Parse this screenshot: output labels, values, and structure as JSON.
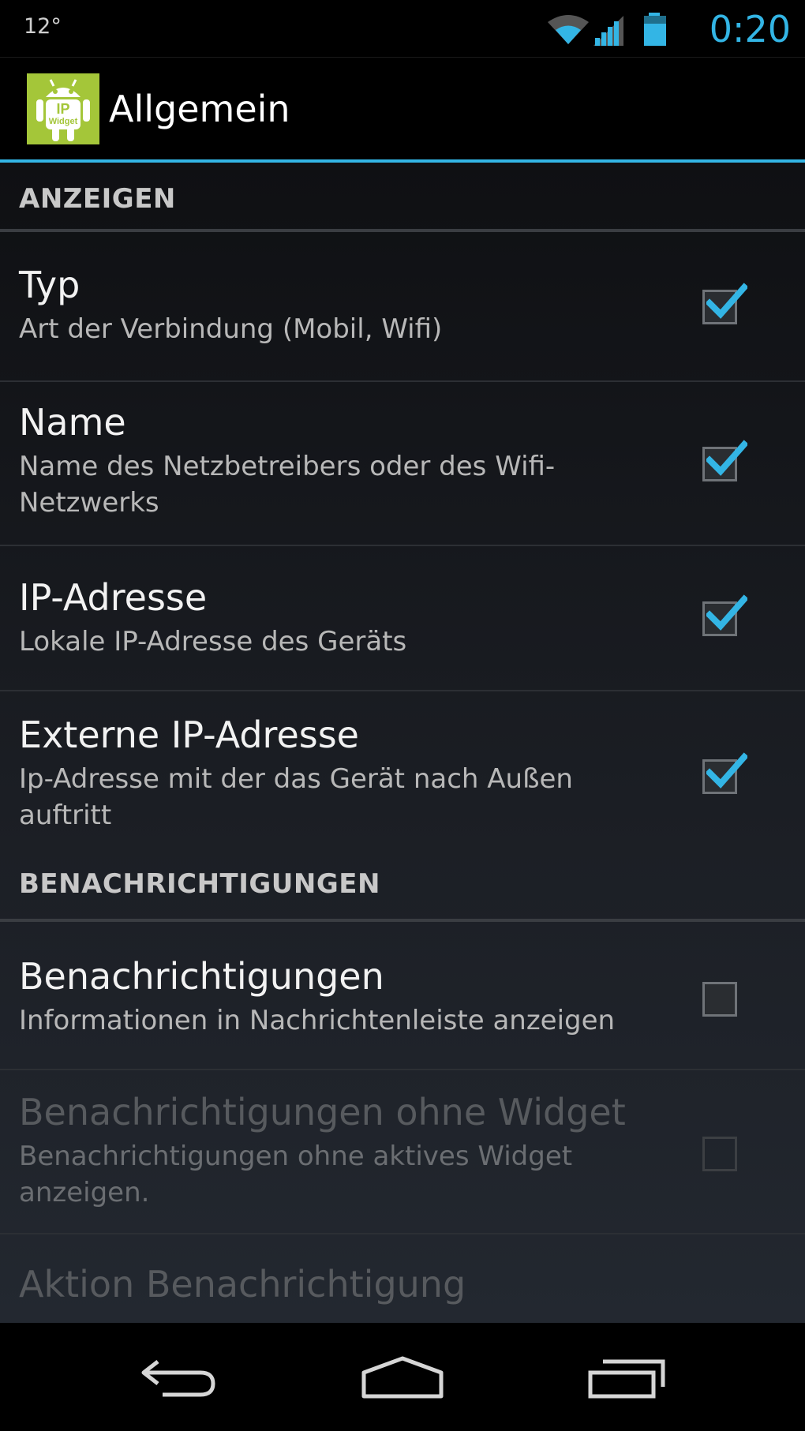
{
  "status_bar": {
    "temperature": "12°",
    "time": "0:20",
    "icons": [
      "wifi-icon",
      "cellular-signal-icon",
      "battery-icon"
    ]
  },
  "action_bar": {
    "title": "Allgemein",
    "app_icon": "ip-widget-android-icon",
    "app_icon_text_1": "IP",
    "app_icon_text_2": "Widget"
  },
  "categories": [
    {
      "label": "ANZEIGEN",
      "items": [
        {
          "title": "Typ",
          "summary": "Art der Verbindung (Mobil, Wifi)",
          "checked": true,
          "enabled": true
        },
        {
          "title": "Name",
          "summary": "Name des Netzbetreibers oder des Wifi-Netzwerks",
          "checked": true,
          "enabled": true
        },
        {
          "title": "IP-Adresse",
          "summary": "Lokale IP-Adresse des Geräts",
          "checked": true,
          "enabled": true
        },
        {
          "title": "Externe IP-Adresse",
          "summary": "Ip-Adresse mit der das Gerät nach Außen auftritt",
          "checked": true,
          "enabled": true
        }
      ]
    },
    {
      "label": "BENACHRICHTIGUNGEN",
      "items": [
        {
          "title": "Benachrichtigungen",
          "summary": "Informationen in Nachrichtenleiste anzeigen",
          "checked": false,
          "enabled": true
        },
        {
          "title": "Benachrichtigungen ohne Widget",
          "summary": "Benachrichtigungen ohne aktives Widget anzeigen.",
          "checked": false,
          "enabled": false
        },
        {
          "title": "Aktion Benachrichtigung",
          "enabled": false
        }
      ]
    }
  ],
  "nav_bar": {
    "buttons": [
      "back-icon",
      "home-icon",
      "recent-apps-icon"
    ]
  },
  "colors": {
    "accent": "#33b5e5",
    "app_icon_bg": "#a4c639"
  }
}
